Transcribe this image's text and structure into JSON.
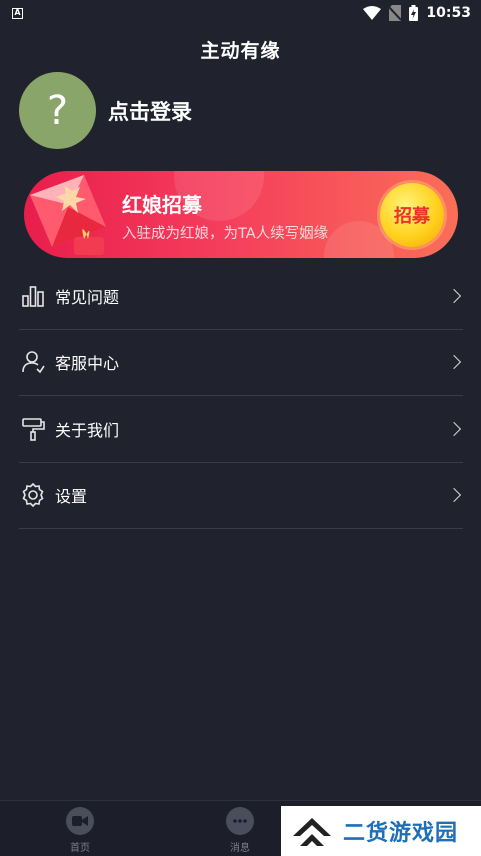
{
  "status_bar": {
    "time": "10:53",
    "notification_icon": "A"
  },
  "header": {
    "title": "主动有缘"
  },
  "profile": {
    "avatar_glyph": "?",
    "login_label": "点击登录"
  },
  "banner": {
    "title": "红娘招募",
    "subtitle": "入驻成为红娘，为TA人续写姻缘",
    "button_label": "招募"
  },
  "menu": {
    "items": [
      {
        "label": "常见问题",
        "icon": "chart-icon"
      },
      {
        "label": "客服中心",
        "icon": "user-service-icon"
      },
      {
        "label": "关于我们",
        "icon": "paint-roller-icon"
      },
      {
        "label": "设置",
        "icon": "gear-icon"
      }
    ]
  },
  "tabbar": {
    "tabs": [
      {
        "label": "首页",
        "icon": "video-icon"
      },
      {
        "label": "消息",
        "icon": "chat-icon"
      }
    ]
  },
  "watermark": {
    "text": "二货游戏园"
  },
  "colors": {
    "background": "#20222e",
    "banner_start": "#e81e4c",
    "banner_end": "#fa6e57",
    "avatar": "#8aa56a",
    "button": "#ffd21e"
  }
}
